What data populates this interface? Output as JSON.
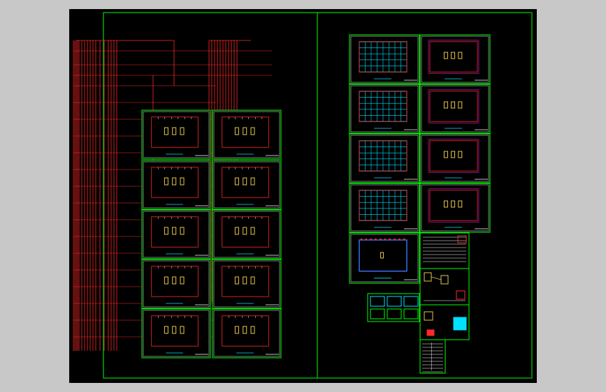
{
  "viewport": {
    "background": "#c8c8c8",
    "canvas_color": "#000000",
    "title": ""
  },
  "colors": {
    "border": "#00ff00",
    "wire": "#ff2a2a",
    "frame": "#ffffff",
    "cyan": "#00e0ff",
    "yellow": "#e5c84a",
    "blue": "#3a78ff",
    "magenta": "#ff33ff"
  },
  "drawing": {
    "left_sheet": {
      "name": "wiring-riser-sheet",
      "floor_plan_count": 10
    },
    "right_sheet": {
      "name": "layout-sheet",
      "floor_plan_count": 9,
      "schematic_count": 4,
      "legend_tables": 2
    }
  }
}
